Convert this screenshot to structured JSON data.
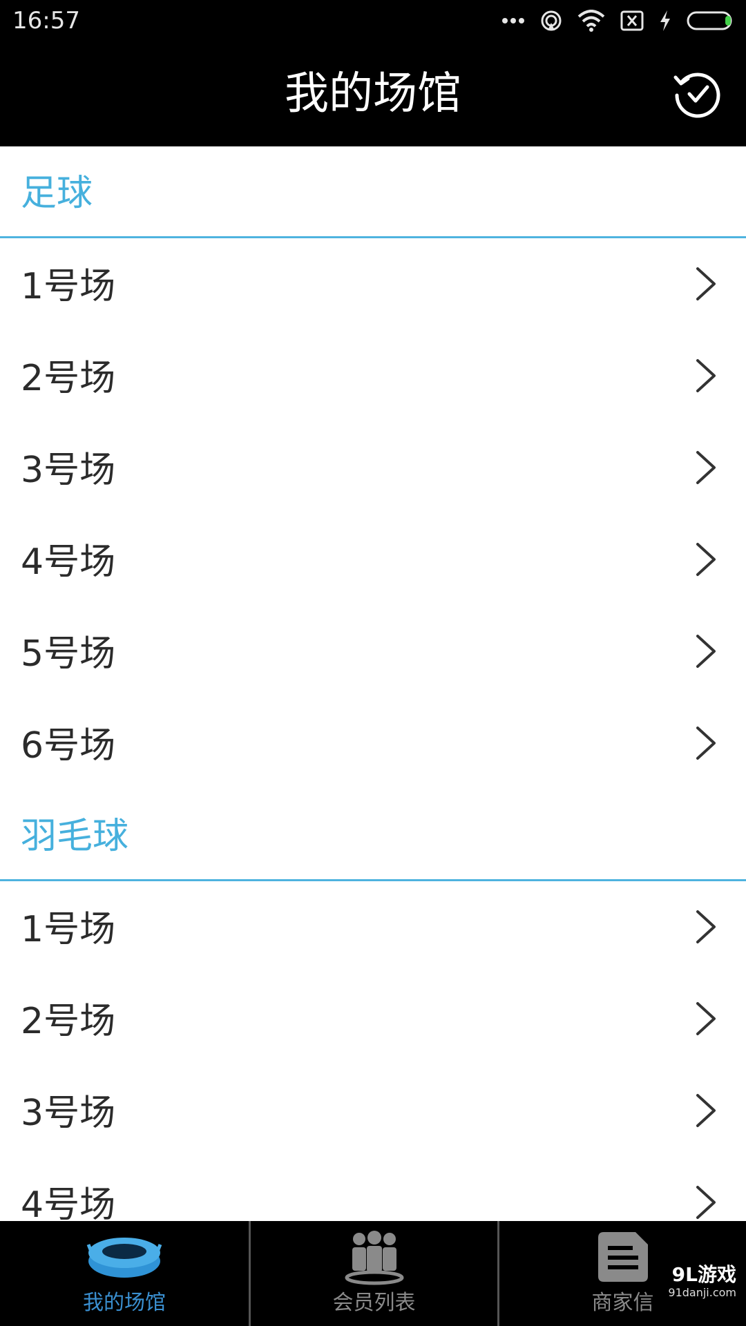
{
  "status_bar": {
    "time": "16:57"
  },
  "header": {
    "title": "我的场馆"
  },
  "sections": [
    {
      "title": "足球",
      "rows": [
        {
          "label": "1号场"
        },
        {
          "label": "2号场"
        },
        {
          "label": "3号场"
        },
        {
          "label": "4号场"
        },
        {
          "label": "5号场"
        },
        {
          "label": "6号场"
        }
      ]
    },
    {
      "title": "羽毛球",
      "rows": [
        {
          "label": "1号场"
        },
        {
          "label": "2号场"
        },
        {
          "label": "3号场"
        },
        {
          "label": "4号场"
        }
      ]
    }
  ],
  "tabs": [
    {
      "label": "我的场馆",
      "icon": "stadium-icon",
      "active": true
    },
    {
      "label": "会员列表",
      "icon": "members-icon",
      "active": false
    },
    {
      "label": "商家信",
      "icon": "document-icon",
      "active": false
    }
  ],
  "watermark": {
    "text": "9L游戏",
    "url": "91danji.com"
  },
  "colors": {
    "accent": "#46b0dd",
    "active_tab": "#3a8fd0",
    "bar_bg": "#000000"
  }
}
